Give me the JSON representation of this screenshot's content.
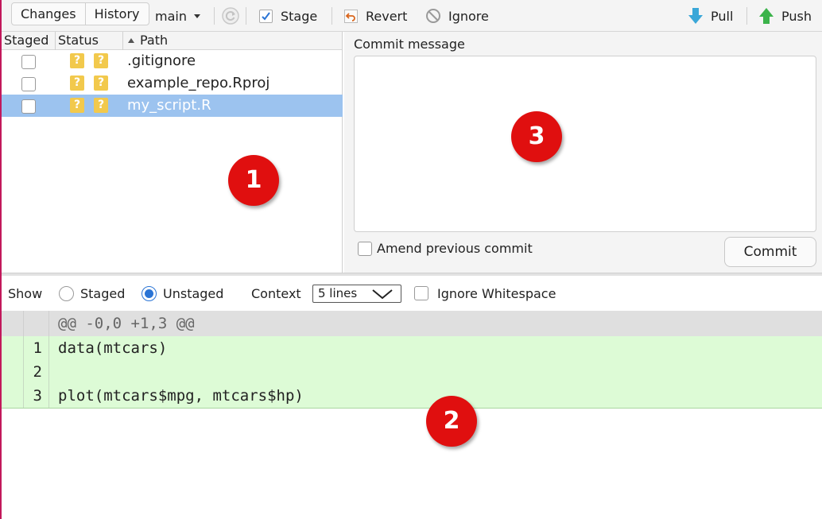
{
  "toolbar": {
    "tabs": [
      "Changes",
      "History"
    ],
    "branch": "main",
    "stage_label": "Stage",
    "revert_label": "Revert",
    "ignore_label": "Ignore",
    "pull_label": "Pull",
    "push_label": "Push"
  },
  "file_list": {
    "columns": [
      "Staged",
      "Status",
      "Path"
    ],
    "rows": [
      {
        "staged": false,
        "status": [
          "?",
          "?"
        ],
        "path": ".gitignore",
        "selected": false
      },
      {
        "staged": false,
        "status": [
          "?",
          "?"
        ],
        "path": "example_repo.Rproj",
        "selected": false
      },
      {
        "staged": false,
        "status": [
          "?",
          "?"
        ],
        "path": "my_script.R",
        "selected": true
      }
    ]
  },
  "commit_panel": {
    "label": "Commit message",
    "message": "",
    "amend_label": "Amend previous commit",
    "commit_button": "Commit"
  },
  "show_bar": {
    "show_label": "Show",
    "staged_label": "Staged",
    "unstaged_label": "Unstaged",
    "selected": "Unstaged",
    "context_label": "Context",
    "context_value": "5 lines",
    "ignore_ws_label": "Ignore Whitespace"
  },
  "diff": {
    "hunk_header": "@@ -0,0 +1,3 @@",
    "lines": [
      {
        "num": "1",
        "text": "data(mtcars)"
      },
      {
        "num": "2",
        "text": ""
      },
      {
        "num": "3",
        "text": "plot(mtcars$mpg, mtcars$hp)"
      }
    ]
  },
  "callouts": [
    "1",
    "2",
    "3"
  ],
  "colors": {
    "selection": "#9cc3ef",
    "added_line": "#ddfbd6",
    "status_badge": "#f2c94c",
    "callout": "#e00f0f",
    "radio_on": "#2a74d5"
  }
}
